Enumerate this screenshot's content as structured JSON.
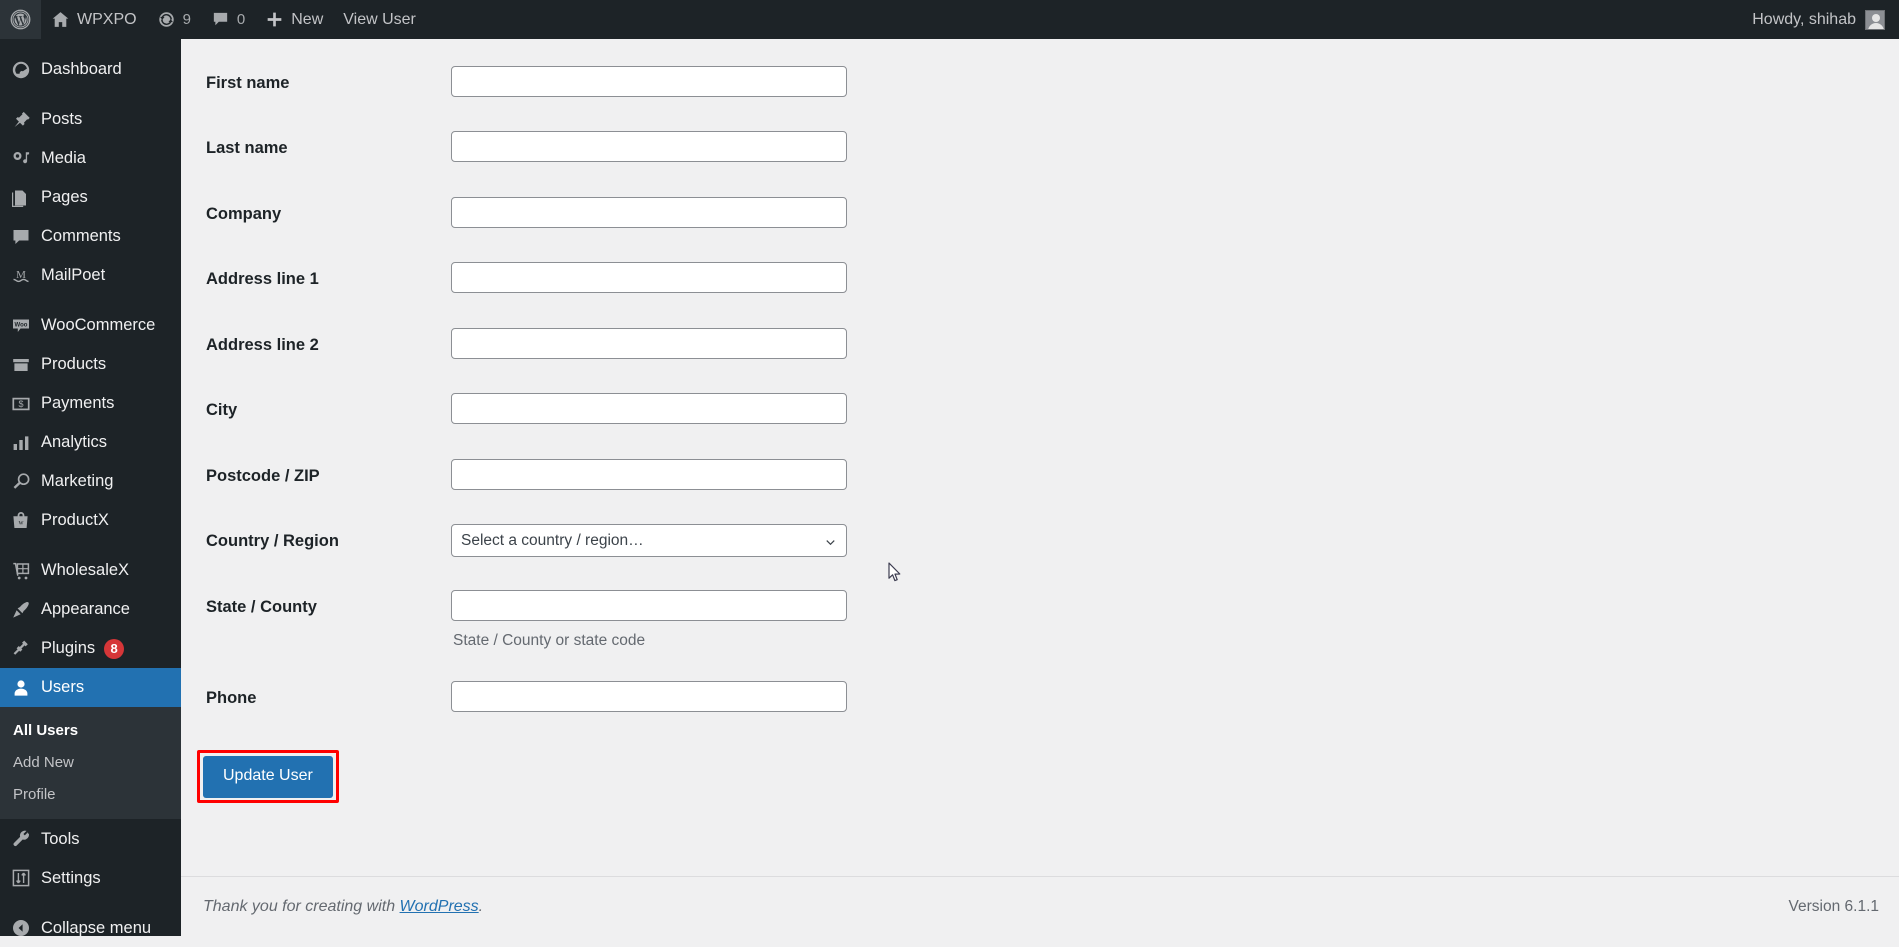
{
  "adminbar": {
    "wp_logo": "wordpress-logo",
    "site_name": "WPXPO",
    "updates_count": "9",
    "comments_count": "0",
    "new_label": "New",
    "view_user_label": "View User",
    "howdy": "Howdy, shihab"
  },
  "sidebar": {
    "items": [
      {
        "label": "Dashboard",
        "icon": "dashboard-icon",
        "current": false
      },
      {
        "label": "Posts",
        "icon": "pin-icon",
        "current": false
      },
      {
        "label": "Media",
        "icon": "media-icon",
        "current": false
      },
      {
        "label": "Pages",
        "icon": "pages-icon",
        "current": false
      },
      {
        "label": "Comments",
        "icon": "comment-icon",
        "current": false
      },
      {
        "label": "MailPoet",
        "icon": "mailpoet-icon",
        "current": false
      },
      {
        "label": "WooCommerce",
        "icon": "woocommerce-icon",
        "current": false
      },
      {
        "label": "Products",
        "icon": "products-icon",
        "current": false
      },
      {
        "label": "Payments",
        "icon": "payments-icon",
        "current": false
      },
      {
        "label": "Analytics",
        "icon": "analytics-icon",
        "current": false
      },
      {
        "label": "Marketing",
        "icon": "megaphone-icon",
        "current": false
      },
      {
        "label": "ProductX",
        "icon": "productx-icon",
        "current": false
      },
      {
        "label": "WholesaleX",
        "icon": "wholesalex-icon",
        "current": false
      },
      {
        "label": "Appearance",
        "icon": "appearance-icon",
        "current": false
      },
      {
        "label": "Plugins",
        "icon": "plugin-icon",
        "current": false,
        "badge": "8"
      },
      {
        "label": "Users",
        "icon": "user-icon",
        "current": true
      },
      {
        "label": "Tools",
        "icon": "wrench-icon",
        "current": false
      },
      {
        "label": "Settings",
        "icon": "settings-icon",
        "current": false
      }
    ],
    "users_submenu": [
      {
        "label": "All Users",
        "current": true
      },
      {
        "label": "Add New",
        "current": false
      },
      {
        "label": "Profile",
        "current": false
      }
    ],
    "collapse_label": "Collapse menu"
  },
  "form": {
    "fields": [
      {
        "label": "First name",
        "type": "text",
        "value": ""
      },
      {
        "label": "Last name",
        "type": "text",
        "value": ""
      },
      {
        "label": "Company",
        "type": "text",
        "value": ""
      },
      {
        "label": "Address line 1",
        "type": "text",
        "value": ""
      },
      {
        "label": "Address line 2",
        "type": "text",
        "value": ""
      },
      {
        "label": "City",
        "type": "text",
        "value": ""
      },
      {
        "label": "Postcode / ZIP",
        "type": "text",
        "value": ""
      },
      {
        "label": "Country / Region",
        "type": "select",
        "value": "Select a country / region…"
      },
      {
        "label": "State / County",
        "type": "text",
        "value": "",
        "description": "State / County or state code"
      },
      {
        "label": "Phone",
        "type": "text",
        "value": ""
      }
    ],
    "submit_label": "Update User",
    "highlight_color": "#ff0000"
  },
  "footer": {
    "thanks_prefix": "Thank you for creating with ",
    "wordpress_link": "WordPress",
    "thanks_suffix": ".",
    "version": "Version 6.1.1"
  },
  "colors": {
    "admin_bg": "#1d2327",
    "accent": "#2271b1",
    "page_bg": "#f0f0f1",
    "badge_red": "#d63638"
  }
}
